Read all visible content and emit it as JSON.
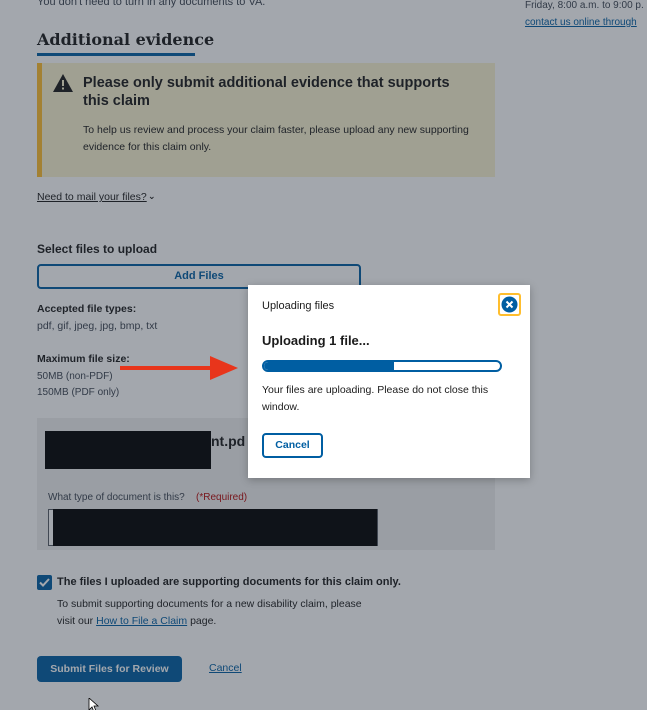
{
  "page": {
    "top_text": "You don't need to turn in any documents to VA.",
    "sidebar_hours": "Friday, 8:00 a.m. to 9:00 p.",
    "sidebar_link": "contact us online through",
    "section_heading": "Additional evidence",
    "alert": {
      "title": "Please only submit additional evidence that supports this claim",
      "body": "To help us review and process your claim faster, please upload any new supporting evidence for this claim only.",
      "icon": "warning-icon",
      "accent_color": "#ffbe2e"
    },
    "mail_link": "Need to mail your files?",
    "select_files_label": "Select files to upload",
    "add_files_button": "Add Files",
    "accepted_types_label": "Accepted file types:",
    "accepted_types_value": "pdf, gif, jpeg, jpg, bmp, txt",
    "max_size_label": "Maximum file size:",
    "max_size_non_pdf": "50MB (non-PDF)",
    "max_size_pdf": "150MB (PDF only)",
    "file_card": {
      "file_name_visible": "nt.pd",
      "doc_type_label": "What type of document is this?",
      "doc_type_required": "(*Required)"
    },
    "checkbox": {
      "checked": true,
      "label": "The files I uploaded are supporting documents for this claim only.",
      "help_prefix": "To submit supporting documents for a new disability claim, please",
      "help_visit": "visit our",
      "help_link": "How to File a Claim",
      "help_suffix": "page."
    },
    "submit_button": "Submit Files for Review",
    "cancel_link": "Cancel"
  },
  "modal": {
    "eyebrow": "Uploading files",
    "title": "Uploading 1 file...",
    "progress_percent": 55,
    "body": "Your files are uploading. Please do not close this window.",
    "cancel_button": "Cancel",
    "close_icon": "close-icon"
  },
  "colors": {
    "primary": "#005ea2",
    "annotation_arrow": "#e8351b",
    "focus_ring": "#ffbe2e"
  }
}
